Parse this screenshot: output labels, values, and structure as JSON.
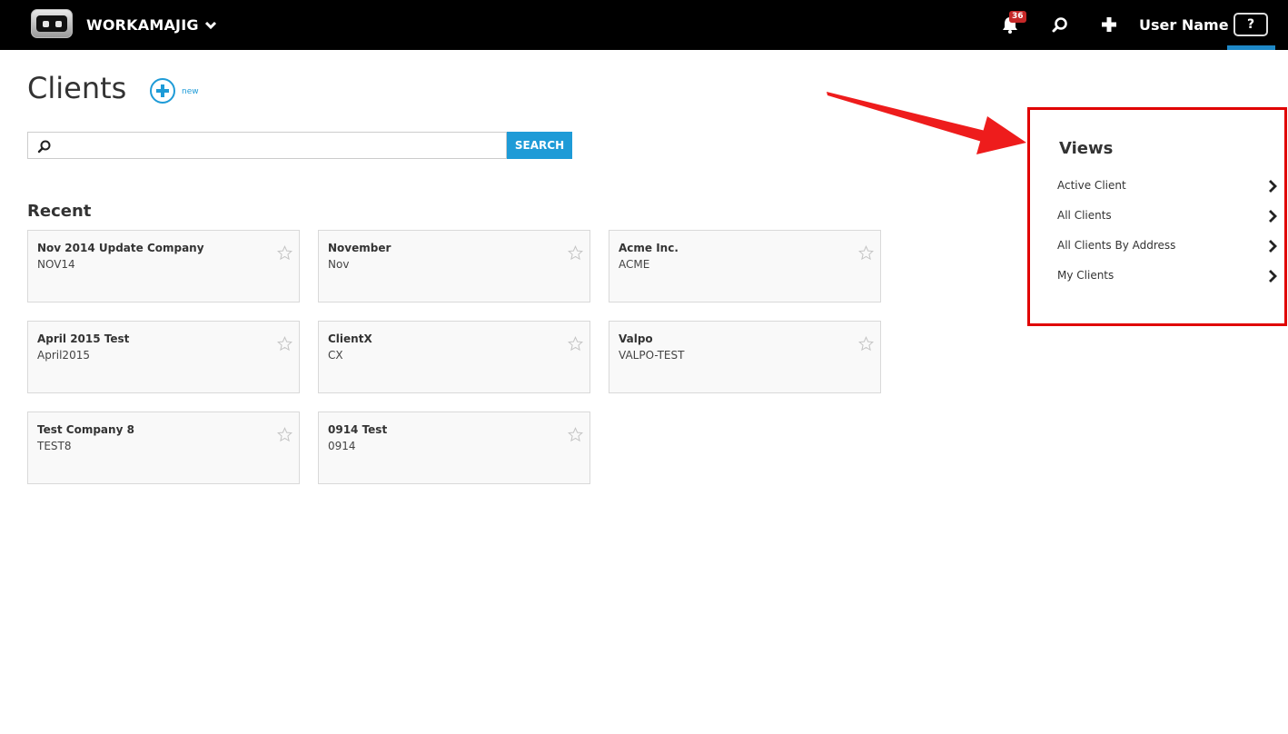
{
  "header": {
    "brand": "WORKAMAJIG",
    "notification_count": "36",
    "user_name": "User Name",
    "help_label": "?",
    "icons": [
      "robot-logo",
      "chevron-down-icon",
      "bell-icon",
      "search-icon",
      "plus-icon",
      "help-icon"
    ]
  },
  "page": {
    "title": "Clients",
    "new_label": "new"
  },
  "search": {
    "value": "",
    "placeholder": "",
    "button_label": "SEARCH"
  },
  "recent": {
    "title": "Recent",
    "clients": [
      {
        "name": "Nov 2014 Update Company",
        "code": "NOV14"
      },
      {
        "name": "November",
        "code": "Nov"
      },
      {
        "name": "Acme Inc.",
        "code": "ACME"
      },
      {
        "name": "April 2015 Test",
        "code": "April2015"
      },
      {
        "name": "ClientX",
        "code": "CX"
      },
      {
        "name": "Valpo",
        "code": "VALPO-TEST"
      },
      {
        "name": "Test Company 8",
        "code": "TEST8"
      },
      {
        "name": "0914 Test",
        "code": "0914"
      }
    ]
  },
  "views": {
    "title": "Views",
    "items": [
      {
        "label": "Active Client"
      },
      {
        "label": "All Clients"
      },
      {
        "label": "All Clients By Address"
      },
      {
        "label": "My Clients"
      }
    ]
  },
  "colors": {
    "accent": "#1e9bd7",
    "topbar": "#000000",
    "annotation": "#e00000",
    "badge": "#c62828"
  }
}
